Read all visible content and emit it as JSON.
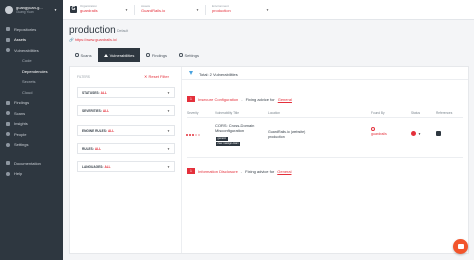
{
  "user": {
    "name": "guangyuan-g...",
    "sub": "Guang Yuan"
  },
  "sidebar": {
    "items": [
      {
        "label": "Repositories",
        "icon": "repo-icon"
      },
      {
        "label": "Assets",
        "icon": "assets-icon",
        "active": true
      },
      {
        "label": "Vulnerabilities",
        "icon": "bug-icon"
      },
      {
        "label": "Code",
        "sub": true
      },
      {
        "label": "Dependencies",
        "sub": true,
        "active": true
      },
      {
        "label": "Secrets",
        "sub": true
      },
      {
        "label": "Cloud",
        "sub": true
      },
      {
        "label": "Findings",
        "icon": "findings-icon"
      },
      {
        "label": "Scans",
        "icon": "scan-icon"
      },
      {
        "label": "Insights",
        "icon": "chart-icon"
      },
      {
        "label": "People",
        "icon": "people-icon"
      },
      {
        "label": "Settings",
        "icon": "gear-icon"
      },
      {
        "label": "Documentation",
        "icon": "doc-icon"
      },
      {
        "label": "Help",
        "icon": "help-icon"
      }
    ]
  },
  "topbar": {
    "organization": {
      "label": "Organization",
      "value": "guardrails"
    },
    "assets": {
      "label": "Assets",
      "value": "GuardRails.io"
    },
    "environment": {
      "label": "Environment",
      "value": "production"
    }
  },
  "page": {
    "title": "production",
    "default_tag": "Default",
    "url": "https://www.guardrails.io/"
  },
  "tabs": [
    {
      "label": "Scans"
    },
    {
      "label": "Vulnerabilities",
      "active": true
    },
    {
      "label": "Findings"
    },
    {
      "label": "Settings"
    }
  ],
  "filters": {
    "heading": "FILTERS",
    "reset_label": "Reset Filter",
    "rows": [
      {
        "label": "STATUSES:",
        "value": "ALL"
      },
      {
        "label": "SEVERITIES:",
        "value": "ALL"
      },
      {
        "label": "ENGINE RULES:",
        "value": "ALL"
      },
      {
        "label": "RULES:",
        "value": "ALL"
      },
      {
        "label": "LANGUAGES:",
        "value": "ALL"
      }
    ]
  },
  "results": {
    "total": "Total: 2 Vulnerabilities",
    "groups": [
      {
        "count": "1",
        "name": "Insecure Configuration",
        "sep": "-",
        "advice": "Fixing advice for",
        "link": "General"
      },
      {
        "count": "1",
        "name": "Information Disclosure",
        "sep": "-",
        "advice": "Fixing advice for",
        "link": "General"
      }
    ],
    "columns": [
      "Severity",
      "Vulnerability Title",
      "Location",
      "Found By",
      "Status",
      "References"
    ],
    "rows": [
      {
        "title": "CORS: Cross-Domain Misconfiguration",
        "tags": [
          "generic",
          "cwe:<assign-cwe>"
        ],
        "location_line1": "GuardRails.io (website)",
        "location_line2": "production",
        "found_by": "guardrails",
        "colors": {
          "severity": "#e4303b"
        }
      }
    ]
  },
  "colors": {
    "accent": "#e4303b",
    "sidebar": "#2e3740",
    "chat": "#f2552c"
  }
}
